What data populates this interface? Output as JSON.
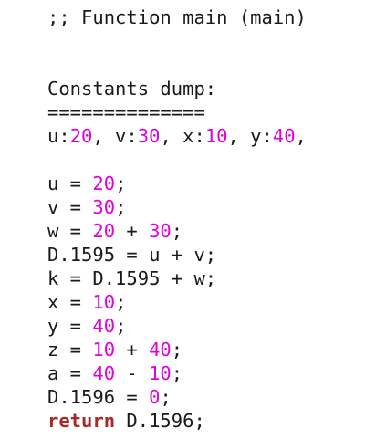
{
  "colors": {
    "text": "#1a1a1a",
    "number": "#e000e0",
    "keyword": "#a52a2a",
    "background": "#ffffff"
  },
  "lines": [
    [
      {
        "t": ";; Function main (main)",
        "c": ""
      }
    ],
    [],
    [],
    [
      {
        "t": "Constants dump:",
        "c": ""
      }
    ],
    [
      {
        "t": "==============",
        "c": ""
      }
    ],
    [
      {
        "t": "u:",
        "c": ""
      },
      {
        "t": "20",
        "c": "num"
      },
      {
        "t": ", v:",
        "c": ""
      },
      {
        "t": "30",
        "c": "num"
      },
      {
        "t": ", x:",
        "c": ""
      },
      {
        "t": "10",
        "c": "num"
      },
      {
        "t": ", y:",
        "c": ""
      },
      {
        "t": "40",
        "c": "num"
      },
      {
        "t": ",",
        "c": ""
      }
    ],
    [],
    [
      {
        "t": "u = ",
        "c": ""
      },
      {
        "t": "20",
        "c": "num"
      },
      {
        "t": ";",
        "c": ""
      }
    ],
    [
      {
        "t": "v = ",
        "c": ""
      },
      {
        "t": "30",
        "c": "num"
      },
      {
        "t": ";",
        "c": ""
      }
    ],
    [
      {
        "t": "w = ",
        "c": ""
      },
      {
        "t": "20",
        "c": "num"
      },
      {
        "t": " + ",
        "c": ""
      },
      {
        "t": "30",
        "c": "num"
      },
      {
        "t": ";",
        "c": ""
      }
    ],
    [
      {
        "t": "D.1595 = u + v;",
        "c": ""
      }
    ],
    [
      {
        "t": "k = D.1595 + w;",
        "c": ""
      }
    ],
    [
      {
        "t": "x = ",
        "c": ""
      },
      {
        "t": "10",
        "c": "num"
      },
      {
        "t": ";",
        "c": ""
      }
    ],
    [
      {
        "t": "y = ",
        "c": ""
      },
      {
        "t": "40",
        "c": "num"
      },
      {
        "t": ";",
        "c": ""
      }
    ],
    [
      {
        "t": "z = ",
        "c": ""
      },
      {
        "t": "10",
        "c": "num"
      },
      {
        "t": " + ",
        "c": ""
      },
      {
        "t": "40",
        "c": "num"
      },
      {
        "t": ";",
        "c": ""
      }
    ],
    [
      {
        "t": "a = ",
        "c": ""
      },
      {
        "t": "40",
        "c": "num"
      },
      {
        "t": " - ",
        "c": ""
      },
      {
        "t": "10",
        "c": "num"
      },
      {
        "t": ";",
        "c": ""
      }
    ],
    [
      {
        "t": "D.1596 = ",
        "c": ""
      },
      {
        "t": "0",
        "c": "num"
      },
      {
        "t": ";",
        "c": ""
      }
    ],
    [
      {
        "t": "return",
        "c": "kw"
      },
      {
        "t": " D.1596;",
        "c": ""
      }
    ]
  ]
}
